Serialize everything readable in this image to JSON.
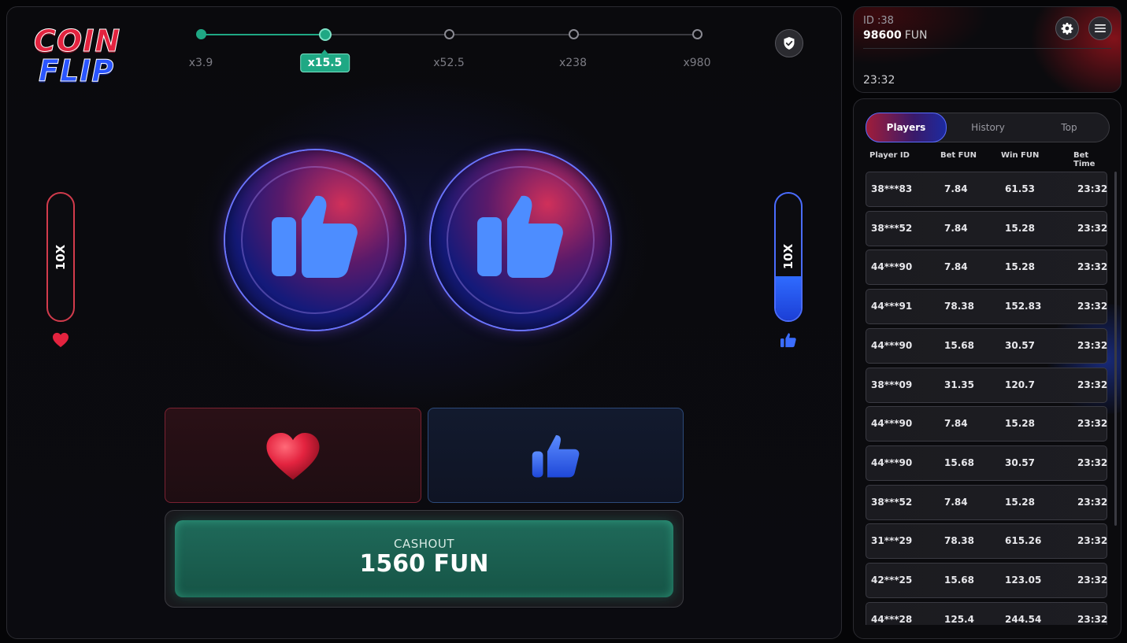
{
  "logo": {
    "line1": "COIN",
    "line2": "FLIP"
  },
  "multipliers": {
    "items": [
      {
        "label": "x3.9",
        "pos": 0.0
      },
      {
        "label": "x15.5",
        "pos": 0.25
      },
      {
        "label": "x52.5",
        "pos": 0.5
      },
      {
        "label": "x238",
        "pos": 0.75
      },
      {
        "label": "x980",
        "pos": 1.0
      }
    ],
    "current_index": 1
  },
  "meters": {
    "left": {
      "label": "10X",
      "fill": 0.0,
      "icon": "heart-icon",
      "color": "#d23b4c"
    },
    "right": {
      "label": "10X",
      "fill": 0.35,
      "icon": "thumbs-up-icon",
      "color": "#4a6cff"
    }
  },
  "coins": [
    {
      "icon": "thumbs-up-icon"
    },
    {
      "icon": "thumbs-up-icon"
    }
  ],
  "choices": [
    {
      "icon": "heart-icon"
    },
    {
      "icon": "thumbs-up-icon"
    }
  ],
  "cashout": {
    "label": "CASHOUT",
    "amount": "1560 FUN"
  },
  "account": {
    "id": "ID :38",
    "balance": "98600",
    "currency": "FUN",
    "time": "23:32"
  },
  "bets": {
    "tabs": [
      "Players",
      "History",
      "Top"
    ],
    "active_tab": "Players",
    "columns": [
      "Player ID",
      "Bet  FUN",
      "Win  FUN",
      "Bet Time"
    ],
    "rows": [
      [
        "38***83",
        "7.84",
        "61.53",
        "23:32"
      ],
      [
        "38***52",
        "7.84",
        "15.28",
        "23:32"
      ],
      [
        "44***90",
        "7.84",
        "15.28",
        "23:32"
      ],
      [
        "44***91",
        "78.38",
        "152.83",
        "23:32"
      ],
      [
        "44***90",
        "15.68",
        "30.57",
        "23:32"
      ],
      [
        "38***09",
        "31.35",
        "120.7",
        "23:32"
      ],
      [
        "44***90",
        "7.84",
        "15.28",
        "23:32"
      ],
      [
        "44***90",
        "15.68",
        "30.57",
        "23:32"
      ],
      [
        "38***52",
        "7.84",
        "15.28",
        "23:32"
      ],
      [
        "31***29",
        "78.38",
        "615.26",
        "23:32"
      ],
      [
        "42***25",
        "15.68",
        "123.05",
        "23:32"
      ],
      [
        "44***28",
        "125.4",
        "244.54",
        "23:32"
      ]
    ]
  },
  "colors": {
    "accent_green": "#1fa884",
    "red": "#e3233f",
    "blue": "#2f6bff"
  }
}
